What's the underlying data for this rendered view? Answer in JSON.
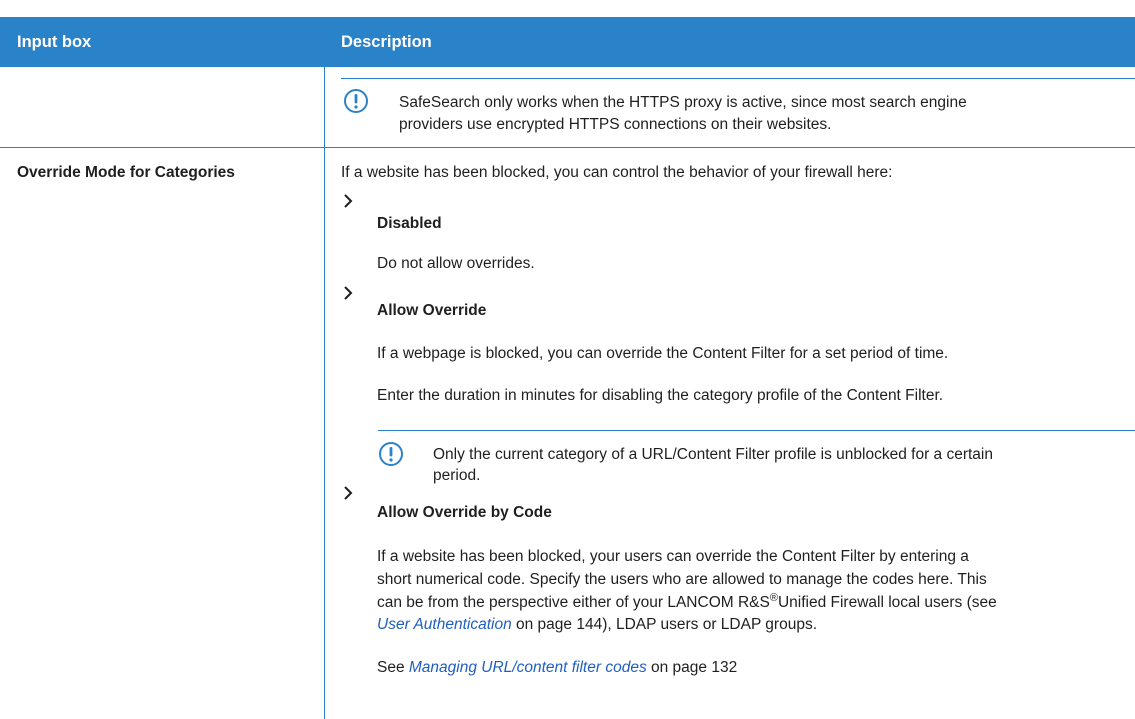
{
  "table": {
    "headers": {
      "input_box": "Input box",
      "description": "Description"
    },
    "row1": {
      "note": {
        "icon": "exclamation-circle-icon",
        "line1": "SafeSearch only works when the HTTPS proxy is active, since most search engine",
        "line2": "providers use encrypted HTTPS connections on their websites."
      }
    },
    "row2": {
      "field": "Override Mode for Categories",
      "intro": "If a website has been blocked, you can control the behavior of your firewall here:",
      "options": [
        {
          "title": "Disabled",
          "text": "Do not allow overrides."
        },
        {
          "title": "Allow Override",
          "text1": "If a webpage is blocked, you can override the Content Filter for a set period of time.",
          "text2": "Enter the duration in minutes for disabling the category profile of the Content Filter.",
          "note_line1": "Only the current category of a URL/Content Filter profile is unblocked for a certain",
          "note_line2": "period."
        },
        {
          "title": "Allow Override by Code",
          "line1": "If a website has been blocked, your users can override the Content Filter by entering a",
          "line2": "short numerical code. Specify the users who are allowed to manage the codes here. This",
          "line3a": "can be from the perspective either of your LANCOM R&S",
          "line3_reg": "®",
          "line3b": "Unified Firewall local users (see",
          "line4_link": "User Authentication",
          "line4_rest": " on page 144), LDAP users or LDAP groups.",
          "see_prefix": "See ",
          "see_link": "Managing URL/content filter codes",
          "see_rest": " on page 132"
        }
      ]
    }
  },
  "colors": {
    "accent": "#2a82c8",
    "header_text": "#ffffff",
    "link": "#1f5fbf"
  }
}
